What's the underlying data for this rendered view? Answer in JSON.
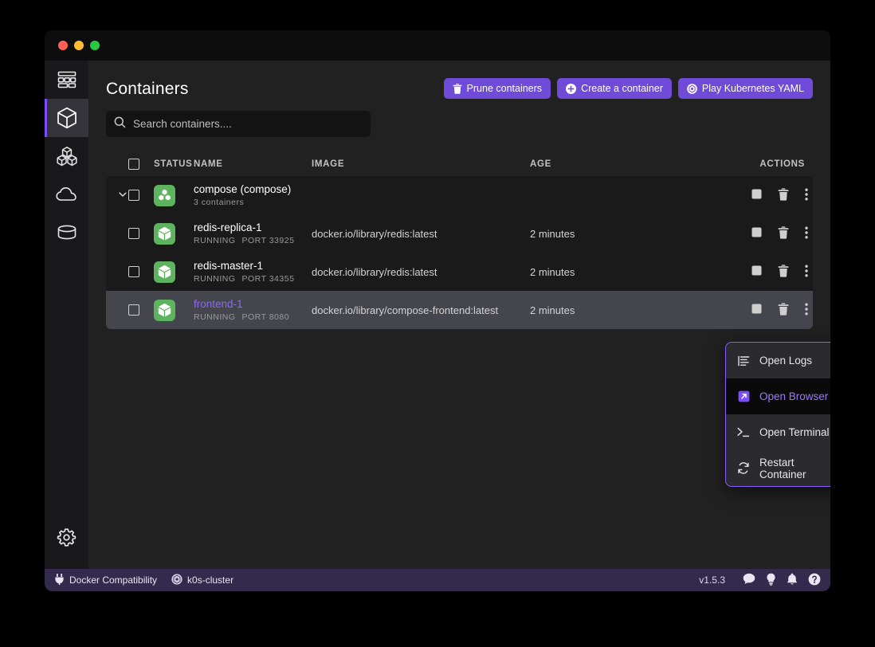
{
  "window": {
    "traffic_lights": [
      "close",
      "minimize",
      "maximize"
    ]
  },
  "sidebar": {
    "items": [
      {
        "id": "dashboard",
        "icon": "dashboard-grid-icon",
        "active": false
      },
      {
        "id": "containers",
        "icon": "cube-icon",
        "active": true
      },
      {
        "id": "images",
        "icon": "stacked-cubes-icon",
        "active": false
      },
      {
        "id": "networks",
        "icon": "cloud-icon",
        "active": false
      },
      {
        "id": "volumes",
        "icon": "database-icon",
        "active": false
      }
    ],
    "footer": {
      "id": "settings",
      "icon": "gear-icon"
    }
  },
  "header": {
    "title": "Containers",
    "buttons": [
      {
        "id": "prune",
        "label": "Prune containers",
        "icon": "trash-icon"
      },
      {
        "id": "create",
        "label": "Create a container",
        "icon": "plus-circle-icon"
      },
      {
        "id": "kubernetes",
        "label": "Play Kubernetes YAML",
        "icon": "kubernetes-icon"
      }
    ]
  },
  "search": {
    "placeholder": "Search containers....",
    "value": "",
    "icon": "search-icon"
  },
  "table": {
    "columns": [
      "STATUS",
      "NAME",
      "IMAGE",
      "AGE",
      "ACTIONS"
    ],
    "rows": [
      {
        "type": "group",
        "expanded": true,
        "name": "compose (compose)",
        "sub": "3 containers",
        "image": "",
        "age": "",
        "status_icon": "compose-stack-icon",
        "accent": false,
        "selected": false
      },
      {
        "type": "container",
        "name": "redis-replica-1",
        "status": "RUNNING",
        "port_label": "PORT 33925",
        "image": "docker.io/library/redis:latest",
        "age": "2 minutes",
        "status_icon": "container-cube-icon",
        "accent": false,
        "selected": false
      },
      {
        "type": "container",
        "name": "redis-master-1",
        "status": "RUNNING",
        "port_label": "PORT 34355",
        "image": "docker.io/library/redis:latest",
        "age": "2 minutes",
        "status_icon": "container-cube-icon",
        "accent": false,
        "selected": false
      },
      {
        "type": "container",
        "name": "frontend-1",
        "status": "RUNNING",
        "port_label": "PORT 8080",
        "image": "docker.io/library/compose-frontend:latest",
        "age": "2 minutes",
        "status_icon": "container-cube-icon",
        "accent": true,
        "selected": true
      }
    ],
    "row_actions": [
      {
        "id": "stop",
        "icon": "stop-square-icon"
      },
      {
        "id": "delete",
        "icon": "trash-icon"
      },
      {
        "id": "more",
        "icon": "kebab-menu-icon"
      }
    ]
  },
  "context_menu": {
    "items": [
      {
        "id": "open-logs",
        "label": "Open Logs",
        "icon": "logs-lines-icon",
        "highlighted": false
      },
      {
        "id": "open-browser",
        "label": "Open Browser",
        "icon": "external-link-icon",
        "highlighted": true
      },
      {
        "id": "open-terminal",
        "label": "Open Terminal",
        "icon": "terminal-prompt-icon",
        "highlighted": false
      },
      {
        "id": "restart-container",
        "label": "Restart Container",
        "icon": "restart-arrows-icon",
        "highlighted": false
      }
    ]
  },
  "status_bar": {
    "left": [
      {
        "id": "docker-compat",
        "label": "Docker Compatibility",
        "icon": "plug-icon"
      },
      {
        "id": "cluster",
        "label": "k0s-cluster",
        "icon": "kubernetes-wheel-icon"
      }
    ],
    "version": "v1.5.3",
    "icons": [
      {
        "id": "feedback",
        "icon": "chat-bubble-icon"
      },
      {
        "id": "tips",
        "icon": "lightbulb-icon"
      },
      {
        "id": "notifications",
        "icon": "bell-icon"
      },
      {
        "id": "help",
        "icon": "question-circle-icon"
      }
    ]
  },
  "colors": {
    "accent_purple": "#6f4bd8",
    "menu_border": "#8b5cf6",
    "status_green": "#5eb35e",
    "status_bar_bg": "#342a4d",
    "window_bg": "#212121",
    "rows_bg": "#1a1a1a",
    "selected_row_bg": "#45454d",
    "link_purple": "#8a6bf0"
  }
}
